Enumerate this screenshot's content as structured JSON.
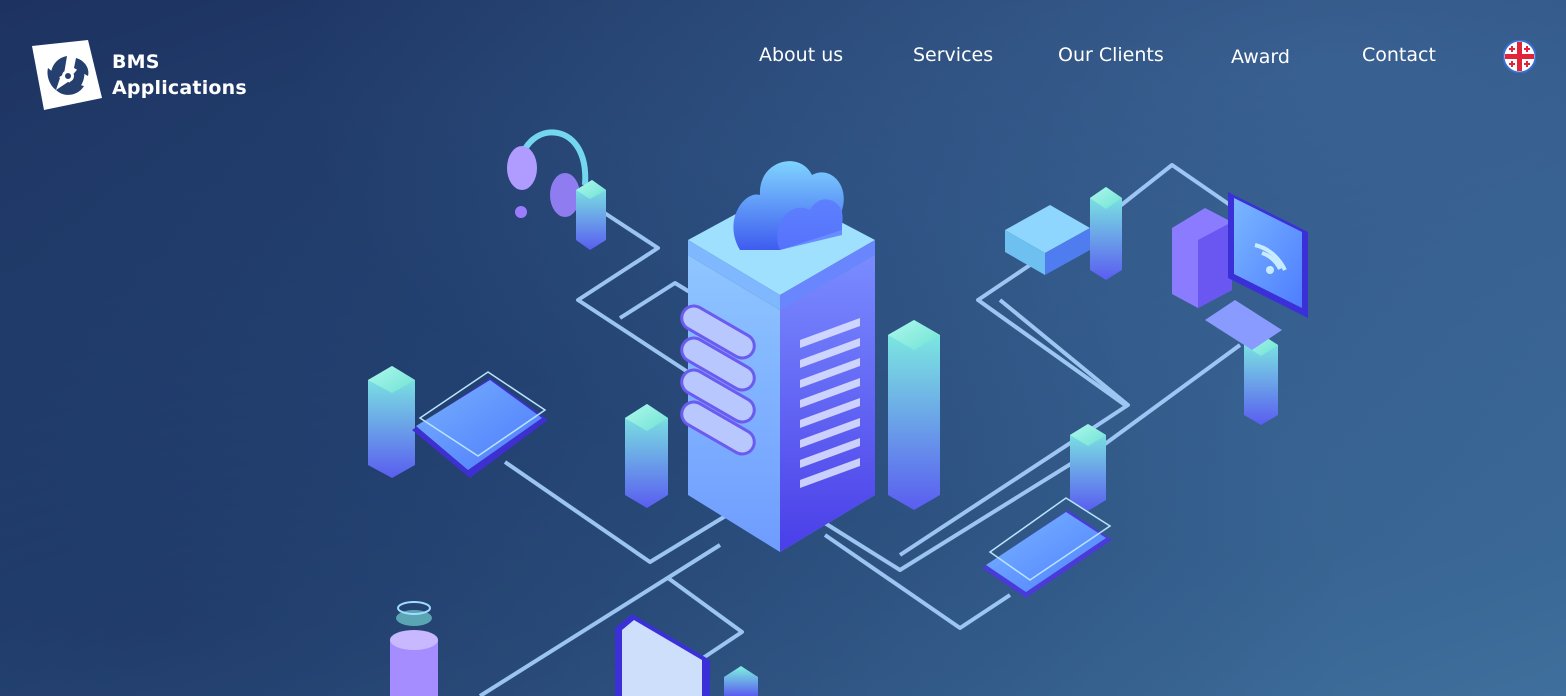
{
  "brand": {
    "name_line1": "BMS",
    "name_line2": "Applications",
    "logo_icon": "aperture-logo-icon"
  },
  "nav": {
    "items": [
      {
        "label": "About us"
      },
      {
        "label": "Services"
      },
      {
        "label": "Our Clients"
      },
      {
        "label": "Award"
      },
      {
        "label": "Contact"
      }
    ]
  },
  "language": {
    "flag_icon": "georgia-flag-icon"
  },
  "colors": {
    "background_dark": "#1d3260",
    "background_light": "#3f6f9c",
    "accent_cyan": "#5ee0d0",
    "accent_blue": "#5b8cff",
    "accent_violet": "#6a4cf0",
    "line_light": "#a9d2ff"
  }
}
